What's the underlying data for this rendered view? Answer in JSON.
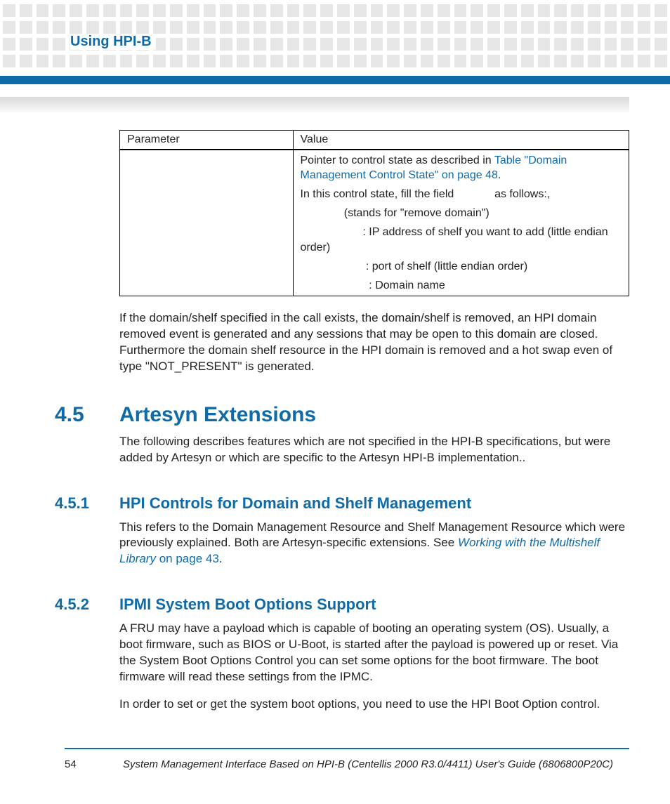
{
  "header": {
    "running_title": "Using HPI-B"
  },
  "table": {
    "headers": {
      "param": "Parameter",
      "value": "Value"
    },
    "row": {
      "p1_pre": "Pointer to control state as described in ",
      "p1_link": "Table \"Domain Management Control State\" on page 48",
      "p1_post": ".",
      "p2": "In this control state, fill the field             as follows:,",
      "p3": "              (stands for \"remove domain\")",
      "p4": "                    : IP address of shelf you want to add (little endian order)",
      "p5": "                     : port of shelf (little endian order)",
      "p6": "                      : Domain name"
    }
  },
  "para_after_table": "If the domain/shelf specified in the call exists, the domain/shelf is removed, an HPI domain removed event is generated and any sessions that may be open to this domain are closed. Furthermore the domain shelf resource in the HPI domain is removed and a hot swap even of type \"NOT_PRESENT\" is generated.",
  "sections": {
    "s45": {
      "num": "4.5",
      "title": "Artesyn Extensions",
      "body": "The following describes features which are not specified in the HPI-B specifications, but were added by Artesyn or which are specific to the Artesyn HPI-B implementation.."
    },
    "s451": {
      "num": "4.5.1",
      "title": "HPI Controls for Domain and Shelf Management",
      "body_pre": "This refers to the Domain Management Resource and Shelf Management Resource which were previously explained. Both are Artesyn-specific extensions. See ",
      "body_link": "Working with the Multishelf Library",
      "body_link2": " on page 43",
      "body_post": "."
    },
    "s452": {
      "num": "4.5.2",
      "title": "IPMI System Boot Options Support",
      "body1": "A FRU may have a payload which is capable of booting an operating system (OS). Usually, a boot firmware, such as BIOS or U-Boot, is started after the payload is powered up or reset. Via the System Boot Options Control you can set some options for the boot firmware. The boot firmware will read these settings from the IPMC.",
      "body2": "In order to set or get the system boot options, you need to use the HPI Boot Option control."
    }
  },
  "footer": {
    "page": "54",
    "text": "System Management Interface Based on HPI-B (Centellis 2000 R3.0/4411) User's Guide (6806800P20C)"
  }
}
